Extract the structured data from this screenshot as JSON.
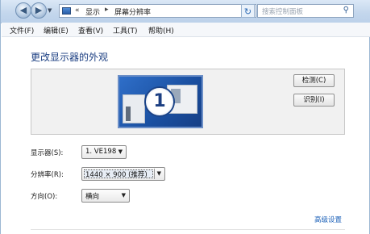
{
  "address_bar": {
    "breadcrumb_sep": "«",
    "crumb1": "显示",
    "crumb_arrow": "▸",
    "crumb2": "屏幕分辨率",
    "search_placeholder": "搜索控制面板"
  },
  "menu": {
    "items": [
      "文件(F)",
      "编辑(E)",
      "查看(V)",
      "工具(T)",
      "帮助(H)"
    ]
  },
  "page": {
    "title": "更改显示器的外观"
  },
  "display_preview": {
    "monitor_number": "1",
    "detect_button": "检测(C)",
    "identify_button": "识别(I)"
  },
  "settings": {
    "display_label": "显示器(S):",
    "display_value": "1. VE198",
    "resolution_label": "分辨率(R):",
    "resolution_value": "1440 × 900 (推荐)",
    "orientation_label": "方向(O):",
    "orientation_value": "横向"
  },
  "advanced_link": "高级设置"
}
